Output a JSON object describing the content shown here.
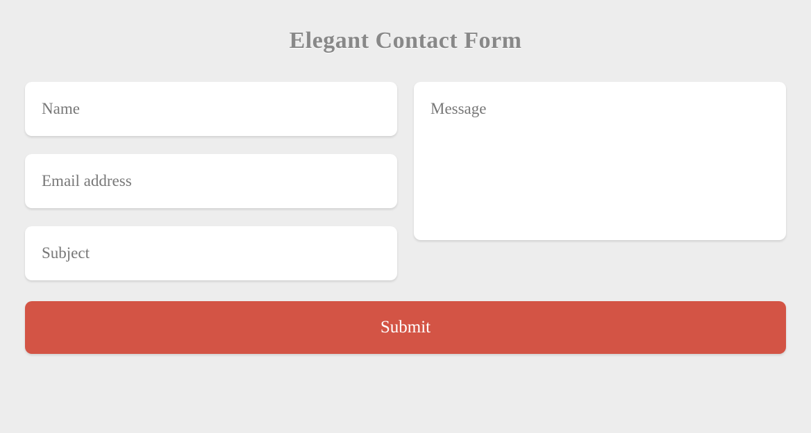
{
  "title": "Elegant Contact Form",
  "fields": {
    "name": {
      "placeholder": "Name",
      "value": ""
    },
    "email": {
      "placeholder": "Email address",
      "value": ""
    },
    "subject": {
      "placeholder": "Subject",
      "value": ""
    },
    "message": {
      "placeholder": "Message",
      "value": ""
    }
  },
  "submit_label": "Submit",
  "colors": {
    "background": "#ededed",
    "accent": "#d35445",
    "title_text": "#888888",
    "placeholder": "#777777"
  }
}
